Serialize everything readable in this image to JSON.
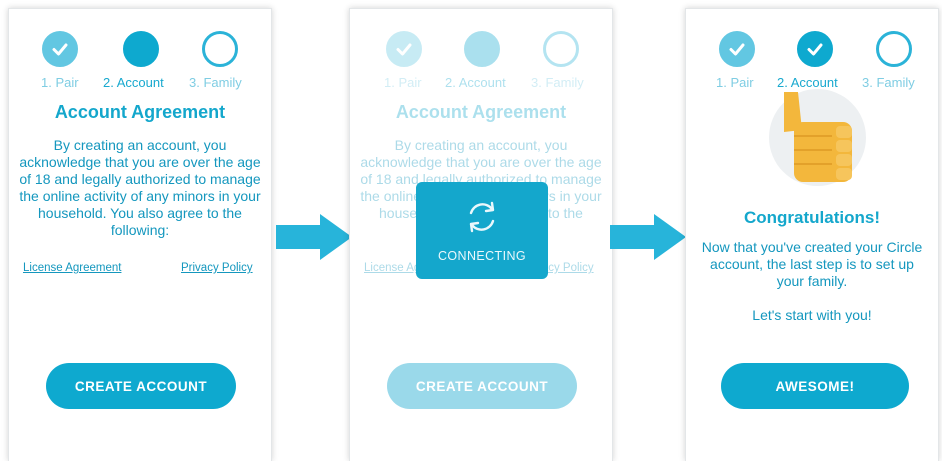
{
  "steps": [
    "1. Pair",
    "2. Account",
    "3. Family"
  ],
  "agreement": {
    "title": "Account Agreement",
    "body": "By creating an account, you acknowledge that you are over the age of 18 and legally authorized to manage the online activity of any minors in your household. You also agree to the following:",
    "license_link": "License Agreement",
    "privacy_link": "Privacy Policy",
    "button": "CREATE ACCOUNT"
  },
  "connecting": {
    "overlay_text": "CONNECTING"
  },
  "congrats": {
    "title": "Congratulations!",
    "body": "Now that you've created your Circle account, the last step is to set up your family.",
    "sub": "Let's start with you!",
    "button": "AWESOME!"
  },
  "colors": {
    "accent": "#0ea9cf",
    "accent_light": "#62c7e2",
    "arrow": "#27b4da",
    "thumb": "#f3b73c"
  },
  "icons": [
    "check-icon",
    "refresh-icon",
    "thumbs-up-icon",
    "arrow-right-icon"
  ]
}
